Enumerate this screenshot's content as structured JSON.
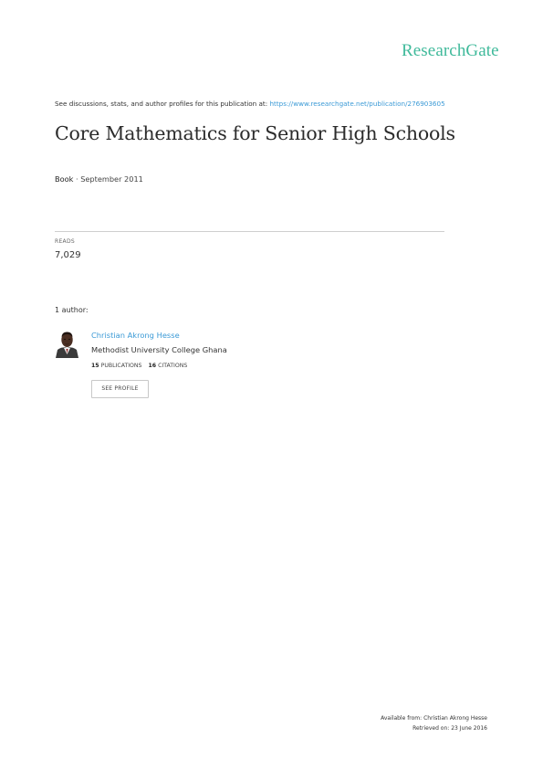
{
  "brand": {
    "logo_text": "ResearchGate",
    "color": "#40ba9b"
  },
  "header": {
    "discuss_text": "See discussions, stats, and author profiles for this publication at: ",
    "discuss_link": "https://www.researchgate.net/publication/276903605"
  },
  "publication": {
    "title": "Core Mathematics for Senior High Schools",
    "type": "Book",
    "date_text": " · September 2011"
  },
  "stats": {
    "reads_label": "READS",
    "reads_value": "7,029"
  },
  "authors": {
    "heading": "1 author:",
    "list": [
      {
        "name": "Christian Akrong Hesse",
        "institution": "Methodist University College Ghana",
        "publications_count": "15",
        "publications_label": " PUBLICATIONS",
        "citations_count": "16",
        "citations_label": " CITATIONS",
        "profile_button": "SEE PROFILE",
        "avatar_icon": "author-photo"
      }
    ]
  },
  "footer": {
    "available_from": "Available from: Christian Akrong Hesse",
    "retrieved_on": "Retrieved on: 23 June 2016"
  },
  "colors": {
    "link": "#3b9ad6",
    "divider": "#cfcfcf"
  }
}
